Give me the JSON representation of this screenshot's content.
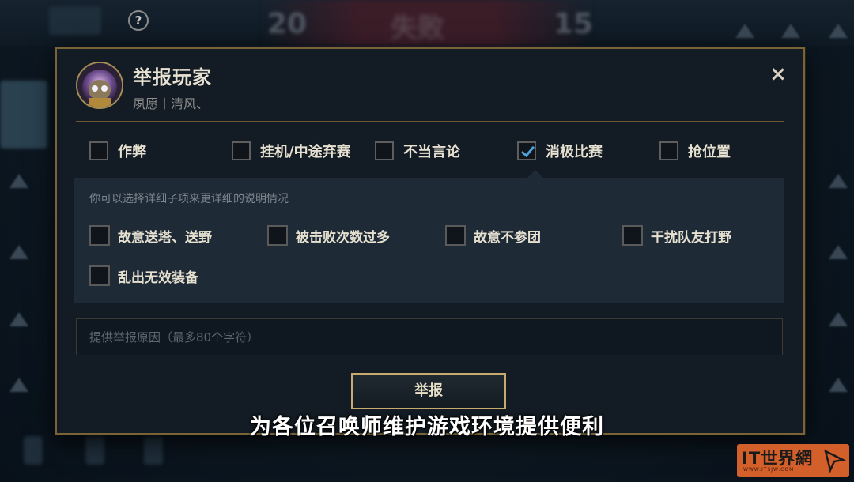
{
  "help_icon": "?",
  "background": {
    "score_left": "20",
    "score_right": "15",
    "result_title": "失败"
  },
  "modal": {
    "title": "举报玩家",
    "player_name": "夙愿丨清风、",
    "close_icon": "×",
    "categories": [
      {
        "label": "作弊",
        "checked": false
      },
      {
        "label": "挂机/中途弃赛",
        "checked": false
      },
      {
        "label": "不当言论",
        "checked": false
      },
      {
        "label": "消极比赛",
        "checked": true
      },
      {
        "label": "抢位置",
        "checked": false
      }
    ],
    "sub_hint": "你可以选择详细子项来更详细的说明情况",
    "sub_options": [
      {
        "label": "故意送塔、送野",
        "checked": false
      },
      {
        "label": "被击败次数过多",
        "checked": false
      },
      {
        "label": "故意不参团",
        "checked": false
      },
      {
        "label": "干扰队友打野",
        "checked": false
      },
      {
        "label": "乱出无效装备",
        "checked": false
      }
    ],
    "reason_placeholder": "提供举报原因（最多80个字符）",
    "submit_label": "举报"
  },
  "subtitle": "为各位召唤师维护游戏环境提供便利",
  "watermark": {
    "text": "IT世界網",
    "sub": "WWW.ITSJW.COM"
  },
  "colors": {
    "accent_gold": "#c8aa6e",
    "check_blue": "#4fa3d8",
    "panel": "#1e2a36",
    "watermark": "#d35f2a"
  }
}
